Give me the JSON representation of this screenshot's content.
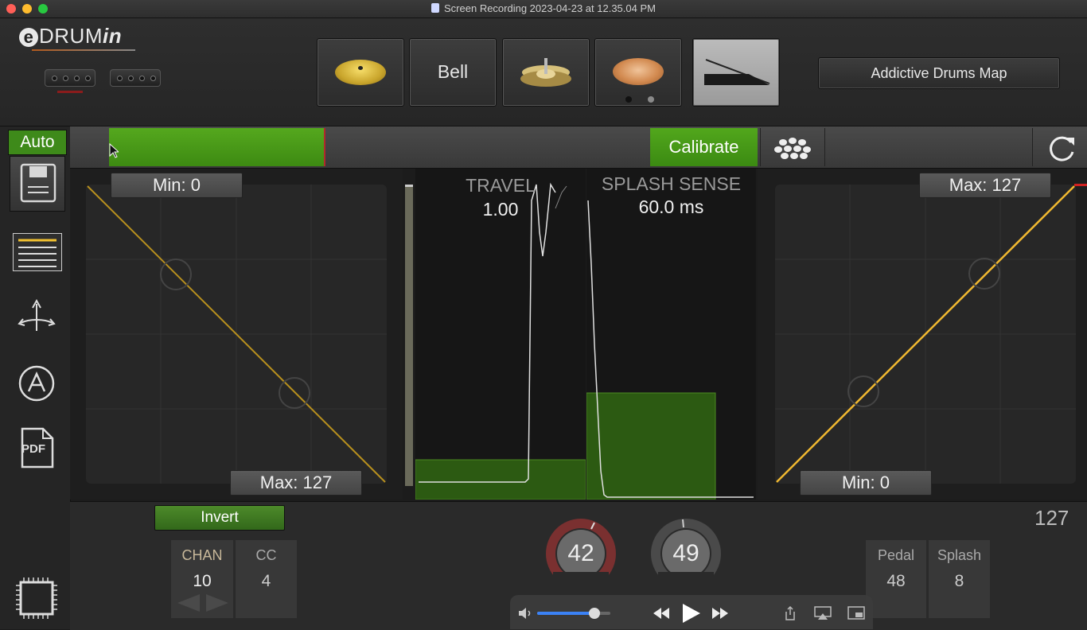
{
  "window": {
    "title": "Screen Recording 2023-04-23 at 12.35.04 PM"
  },
  "header": {
    "logo": {
      "e": "e",
      "drum": "DRUM",
      "in": "in"
    },
    "pads": [
      {
        "icon": "ride-cymbal-icon"
      },
      {
        "label": "Bell"
      },
      {
        "icon": "hihat-stack-icon"
      },
      {
        "icon": "splash-cymbal-icon"
      },
      {
        "icon": "pedal-icon"
      }
    ],
    "map_button": "Addictive Drums Map"
  },
  "sidebar": {
    "auto": "Auto",
    "icons": [
      "save-icon",
      "list-icon",
      "arrows-split-icon",
      "auto-a-icon",
      "pdf-icon",
      "chip-icon"
    ],
    "pdf_text": "PDF"
  },
  "toolbar": {
    "calibrate": "Calibrate",
    "level": 0.53
  },
  "left_curve": {
    "min_label": "Min: 0",
    "max_label": "Max: 127"
  },
  "right_curve": {
    "min_label": "Min: 0",
    "max_label": "Max: 127"
  },
  "travel": {
    "title": "TRAVEL",
    "value": "1.00"
  },
  "splash": {
    "title": "SPLASH SENSE",
    "value": "60.0 ms"
  },
  "bottom": {
    "invert": "Invert",
    "chan": {
      "label": "CHAN",
      "value": "10"
    },
    "cc": {
      "label": "CC",
      "value": "4"
    },
    "knob_left": "42",
    "knob_right": "49",
    "pedal": {
      "label": "Pedal",
      "value": "48"
    },
    "splash": {
      "label": "Splash",
      "value": "8"
    },
    "max_readout": "127"
  },
  "player": {
    "volume": 0.78
  },
  "colors": {
    "accent_green": "#4a9a18",
    "curve_yellow": "#f0b830",
    "alert_red": "#b12a2a"
  }
}
